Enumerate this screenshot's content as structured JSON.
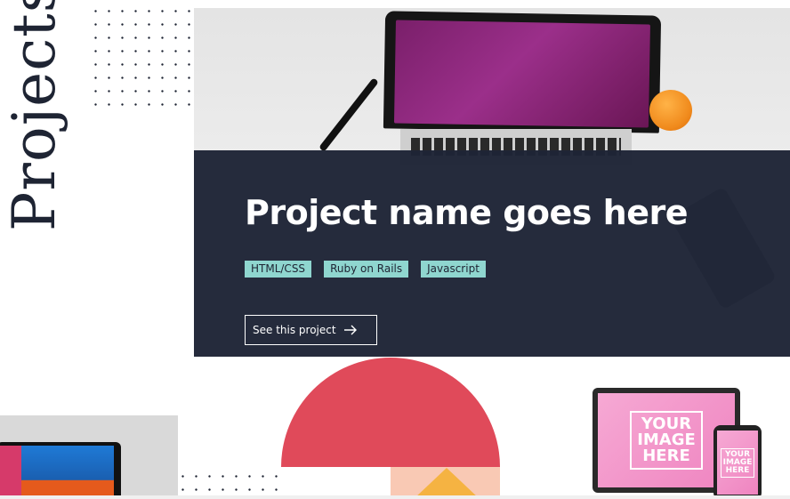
{
  "section": {
    "title": "Projects"
  },
  "featured": {
    "title": "Project name goes here",
    "tags": [
      "HTML/CSS",
      "Ruby on Rails",
      "Javascript"
    ],
    "cta_label": "See this project",
    "overlay_color": "#1e2436",
    "tag_color": "#8fd6cf"
  },
  "thumbnails": {
    "right_mockup_text": "YOUR\nIMAGE\nHERE",
    "right_phone_text": "YOUR\nIMAGE\nHERE"
  },
  "icons": {
    "cta_arrow": "arrow-right-icon"
  }
}
